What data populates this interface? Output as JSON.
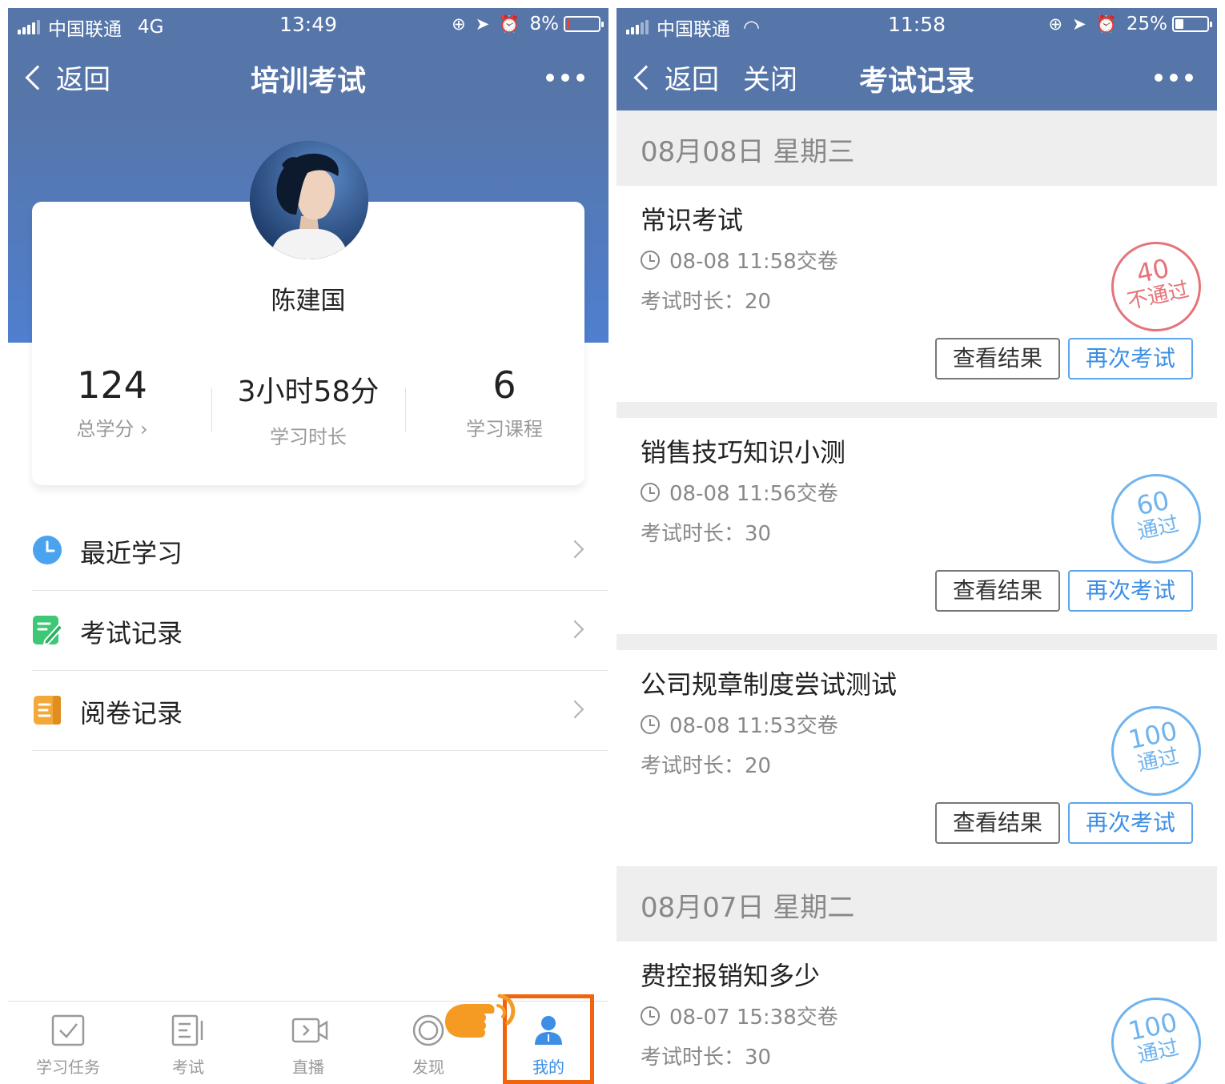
{
  "colors": {
    "nav_blue": "#5676aa",
    "accent_blue": "#3d8fe6",
    "pass_blue": "#6fb3ee",
    "fail_red": "#e5747a",
    "highlight_orange": "#f2630d"
  },
  "left": {
    "status_bar": {
      "carrier": "中国联通",
      "network": "4G",
      "time": "13:49",
      "battery": "8%"
    },
    "nav": {
      "back": "返回",
      "title": "培训考试",
      "more_icon": "more-dots-icon"
    },
    "profile": {
      "name": "陈建国",
      "stats": [
        {
          "value": "124",
          "label": "总学分 ›"
        },
        {
          "value": "3小时58分",
          "label": "学习时长"
        },
        {
          "value": "6",
          "label": "学习课程"
        }
      ]
    },
    "menu": [
      {
        "label": "最近学习",
        "icon": "clock-icon",
        "color": "#4aa3ef"
      },
      {
        "label": "考试记录",
        "icon": "edit-icon",
        "color": "#3ec775"
      },
      {
        "label": "阅卷记录",
        "icon": "document-icon",
        "color": "#f3a83b"
      }
    ],
    "tabs": [
      {
        "label": "学习任务",
        "icon": "checkbox-icon"
      },
      {
        "label": "考试",
        "icon": "exam-icon"
      },
      {
        "label": "直播",
        "icon": "video-icon"
      },
      {
        "label": "发现",
        "icon": "discover-icon"
      },
      {
        "label": "我的",
        "icon": "user-icon",
        "active": true
      }
    ]
  },
  "right": {
    "status_bar": {
      "carrier": "中国联通",
      "time": "11:58",
      "battery": "25%"
    },
    "nav": {
      "back": "返回",
      "close": "关闭",
      "title": "考试记录",
      "more_icon": "more-dots-icon"
    },
    "groups": [
      {
        "date": "08月08日  星期三",
        "records": [
          {
            "title": "常识考试",
            "time": "08-08 11:58交卷",
            "duration": "考试时长：20",
            "score": "40",
            "status": "不通过",
            "passed": false,
            "view": "查看结果",
            "retake": "再次考试"
          },
          {
            "title": "销售技巧知识小测",
            "time": "08-08 11:56交卷",
            "duration": "考试时长：30",
            "score": "60",
            "status": "通过",
            "passed": true,
            "view": "查看结果",
            "retake": "再次考试"
          },
          {
            "title": "公司规章制度尝试测试",
            "time": "08-08 11:53交卷",
            "duration": "考试时长：20",
            "score": "100",
            "status": "通过",
            "passed": true,
            "view": "查看结果",
            "retake": "再次考试"
          }
        ]
      },
      {
        "date": "08月07日  星期二",
        "records": [
          {
            "title": "费控报销知多少",
            "time": "08-07 15:38交卷",
            "duration": "考试时长：30",
            "score": "100",
            "status": "通过",
            "passed": true
          }
        ]
      }
    ]
  }
}
